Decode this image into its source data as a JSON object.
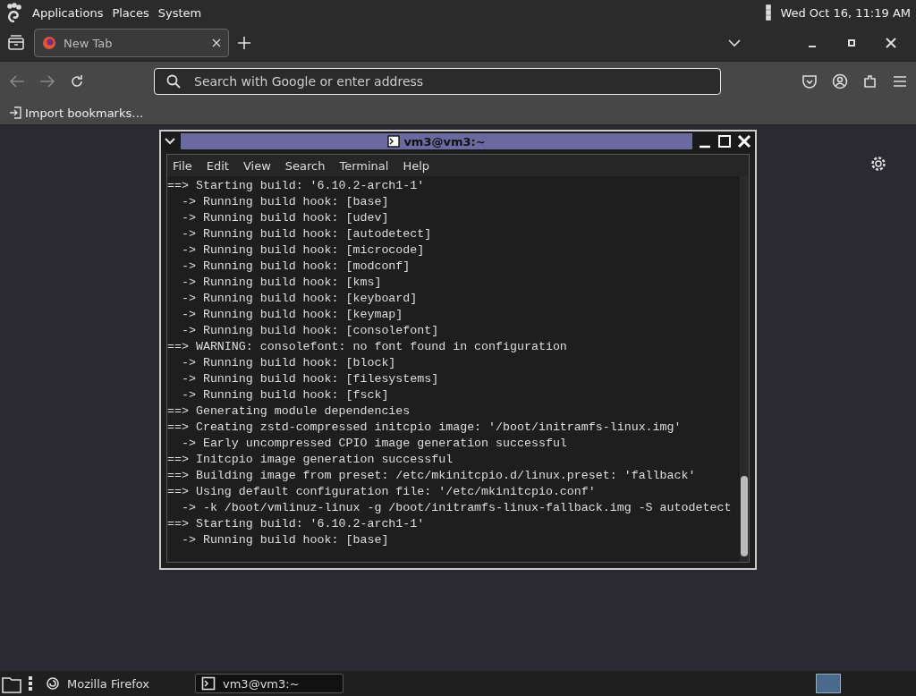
{
  "top_panel": {
    "menus": [
      "Applications",
      "Places",
      "System"
    ],
    "clock": "Wed Oct 16, 11:19 AM"
  },
  "browser": {
    "tabs": [
      {
        "label": "New Tab",
        "selected": true
      }
    ],
    "address_bar": {
      "placeholder": "Search with Google or enter address"
    },
    "bookmarks": [
      "Import bookmarks…"
    ]
  },
  "terminal": {
    "title": "vm3@vm3:~",
    "menu": [
      "File",
      "Edit",
      "View",
      "Search",
      "Terminal",
      "Help"
    ],
    "lines": [
      "==> Starting build: '6.10.2-arch1-1'",
      "  -> Running build hook: [base]",
      "  -> Running build hook: [udev]",
      "  -> Running build hook: [autodetect]",
      "  -> Running build hook: [microcode]",
      "  -> Running build hook: [modconf]",
      "  -> Running build hook: [kms]",
      "  -> Running build hook: [keyboard]",
      "  -> Running build hook: [keymap]",
      "  -> Running build hook: [consolefont]",
      "==> WARNING: consolefont: no font found in configuration",
      "  -> Running build hook: [block]",
      "  -> Running build hook: [filesystems]",
      "  -> Running build hook: [fsck]",
      "==> Generating module dependencies",
      "==> Creating zstd-compressed initcpio image: '/boot/initramfs-linux.img'",
      "  -> Early uncompressed CPIO image generation successful",
      "==> Initcpio image generation successful",
      "==> Building image from preset: /etc/mkinitcpio.d/linux.preset: 'fallback'",
      "==> Using default configuration file: '/etc/mkinitcpio.conf'",
      "  -> -k /boot/vmlinuz-linux -g /boot/initramfs-linux-fallback.img -S autodetect",
      "==> Starting build: '6.10.2-arch1-1'",
      "  -> Running build hook: [base]"
    ]
  },
  "taskbar": {
    "items": [
      {
        "kind": "browser",
        "label": "Mozilla Firefox",
        "selected": false
      },
      {
        "kind": "terminal",
        "label": "vm3@vm3:~",
        "selected": true
      }
    ]
  }
}
